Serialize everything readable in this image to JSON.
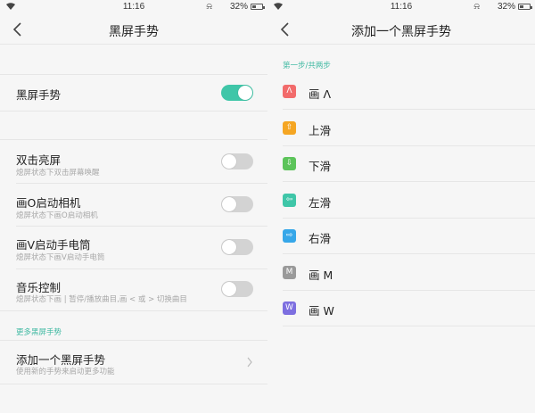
{
  "left": {
    "status": {
      "time": "11:16",
      "battery": "32%"
    },
    "title": "黑屏手势",
    "master": {
      "label": "黑屏手势",
      "on": true
    },
    "items": [
      {
        "label": "双击亮屏",
        "sub": "熄屏状态下双击屏幕唤醒",
        "on": false
      },
      {
        "label": "画O启动相机",
        "sub": "熄屏状态下画O启动相机",
        "on": false
      },
      {
        "label": "画V启动手电筒",
        "sub": "熄屏状态下画V启动手电筒",
        "on": false
      },
      {
        "label": "音乐控制",
        "sub": "熄屏状态下画 | 暂停/播放曲目,画 < 或 > 切换曲目",
        "on": false
      }
    ],
    "more_section": "更多黑屏手势",
    "add": {
      "label": "添加一个黑屏手势",
      "sub": "使用新的手势来启动更多功能"
    }
  },
  "right": {
    "status": {
      "time": "11:16",
      "battery": "32%"
    },
    "title": "添加一个黑屏手势",
    "step": "第一步/共两步",
    "gestures": [
      {
        "label": "画 Λ",
        "glyph": "Λ",
        "color": "#f26b6b",
        "icon": "draw-lambda-icon"
      },
      {
        "label": "上滑",
        "glyph": "⇧",
        "color": "#f5a623",
        "icon": "swipe-up-icon"
      },
      {
        "label": "下滑",
        "glyph": "⇩",
        "color": "#5cc45a",
        "icon": "swipe-down-icon"
      },
      {
        "label": "左滑",
        "glyph": "⇦",
        "color": "#3fc6a8",
        "icon": "swipe-left-icon"
      },
      {
        "label": "右滑",
        "glyph": "⇨",
        "color": "#36a7e9",
        "icon": "swipe-right-icon"
      },
      {
        "label": "画 M",
        "glyph": "M",
        "color": "#9a9a9a",
        "icon": "draw-m-icon"
      },
      {
        "label": "画 W",
        "glyph": "W",
        "color": "#7d6fe0",
        "icon": "draw-w-icon"
      }
    ]
  },
  "colors": {
    "accent": "#3fc6a8",
    "section": "#3fb9a2",
    "toggle_off": "#d3d3d3"
  }
}
